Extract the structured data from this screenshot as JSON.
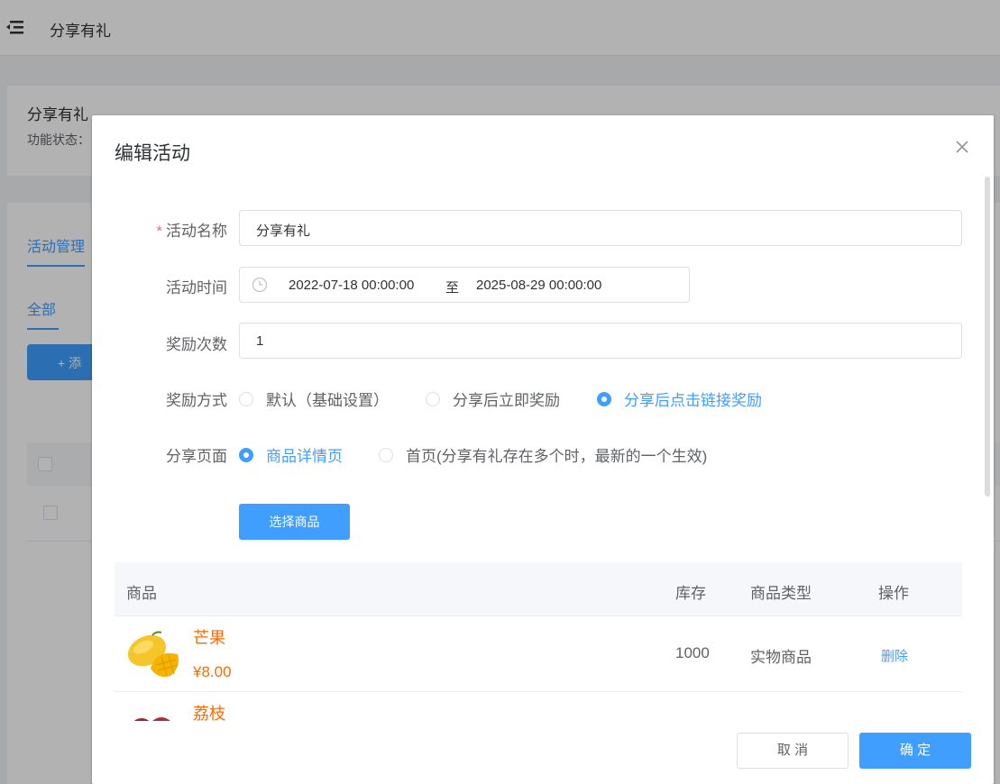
{
  "background": {
    "topbar_title": "分享有礼",
    "info_title": "分享有礼",
    "info_status_label": "功能状态：",
    "tab_manage": "活动管理",
    "tab_all": "全部",
    "add_button": "+ 添"
  },
  "dialog": {
    "title": "编辑活动",
    "form": {
      "name_label": "活动名称",
      "name_value": "分享有礼",
      "time_label": "活动时间",
      "time_start": "2022-07-18 00:00:00",
      "time_separator": "至",
      "time_end": "2025-08-29 00:00:00",
      "reward_count_label": "奖励次数",
      "reward_count_value": "1",
      "reward_method_label": "奖励方式",
      "reward_methods": [
        {
          "label": "默认（基础设置）",
          "checked": false
        },
        {
          "label": "分享后立即奖励",
          "checked": false
        },
        {
          "label": "分享后点击链接奖励",
          "checked": true
        }
      ],
      "share_page_label": "分享页面",
      "share_pages": [
        {
          "label": "商品详情页",
          "checked": true
        },
        {
          "label": "首页(分享有礼存在多个时，最新的一个生效)",
          "checked": false
        }
      ],
      "select_product_button": "选择商品"
    },
    "table": {
      "columns": [
        "商品",
        "库存",
        "商品类型",
        "操作"
      ],
      "rows": [
        {
          "name": "芒果",
          "price": "¥8.00",
          "stock": "1000",
          "type": "实物商品",
          "action": "删除",
          "image": "mango-image"
        },
        {
          "name": "荔枝",
          "price": "",
          "stock": "",
          "type": "",
          "action": "",
          "image": "lychee-image"
        }
      ]
    },
    "footer": {
      "cancel_label": "取 消",
      "confirm_label": "确 定"
    }
  },
  "colors": {
    "primary": "#409eff",
    "price": "#ff6a00",
    "required": "#f56c6c"
  }
}
